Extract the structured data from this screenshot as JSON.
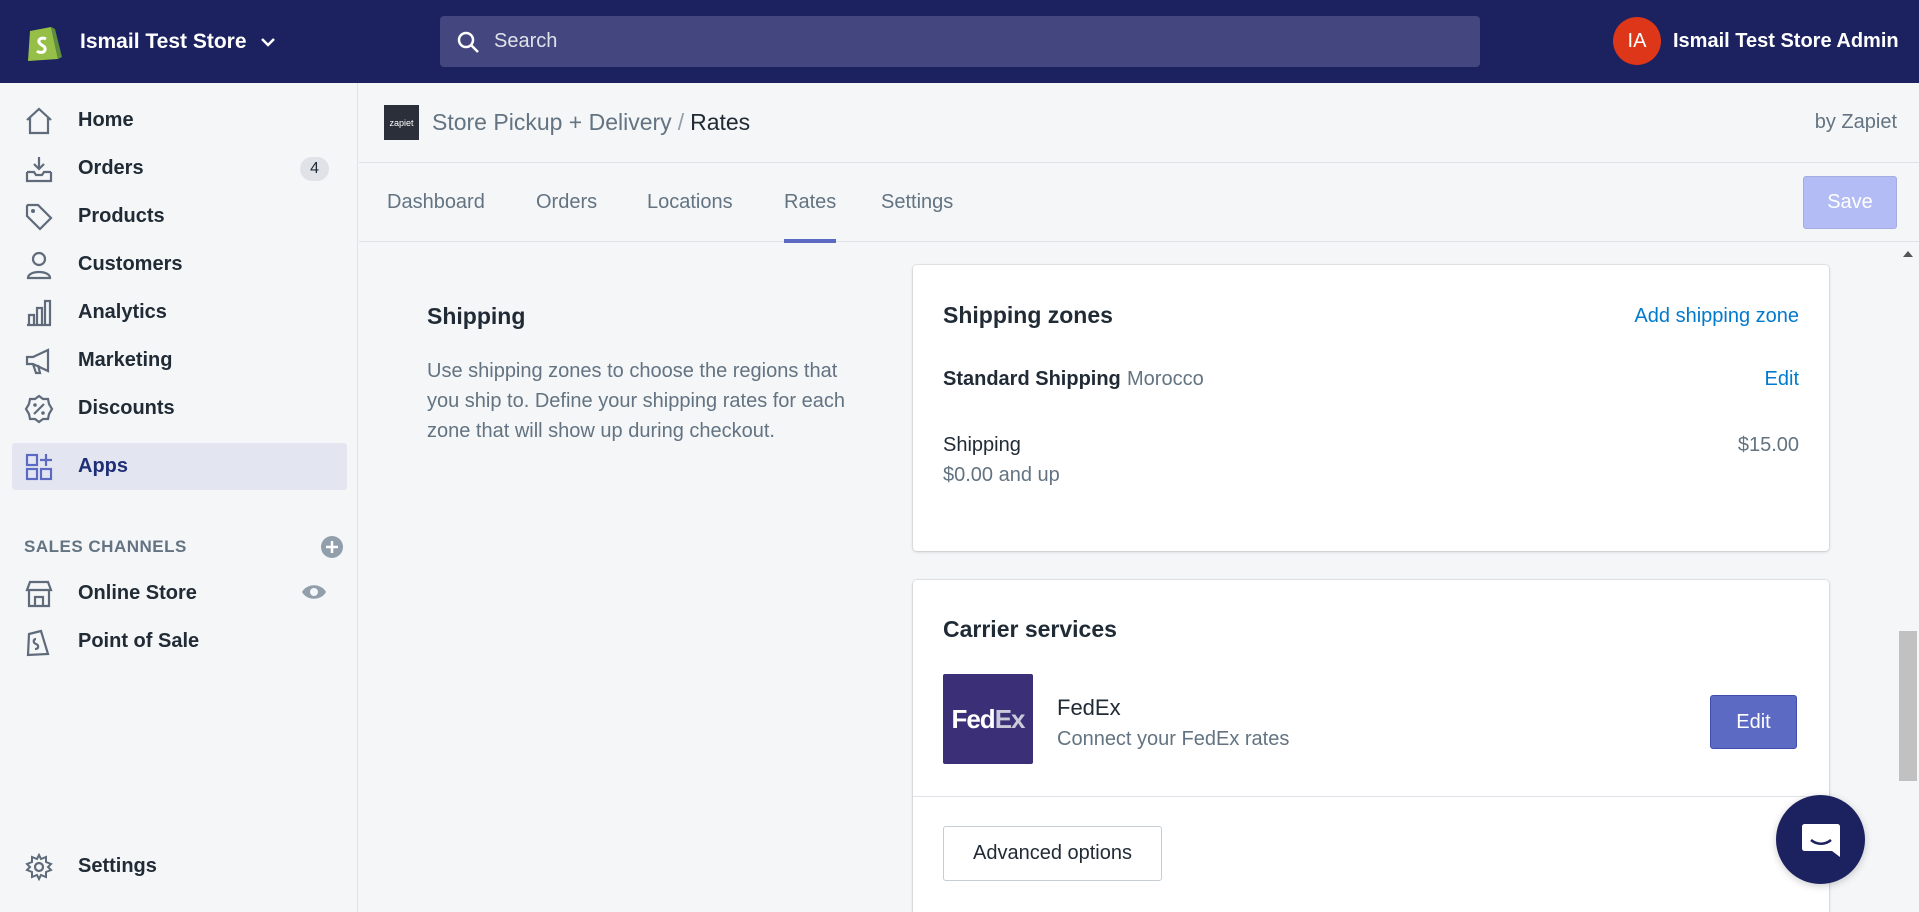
{
  "topbar": {
    "store_name": "Ismail Test Store",
    "search_placeholder": "Search",
    "avatar_initials": "IA",
    "account_name": "Ismail Test Store Admin"
  },
  "sidebar": {
    "items": [
      {
        "label": "Home",
        "icon": "home-icon"
      },
      {
        "label": "Orders",
        "icon": "orders-icon",
        "badge": "4"
      },
      {
        "label": "Products",
        "icon": "tag-icon"
      },
      {
        "label": "Customers",
        "icon": "person-icon"
      },
      {
        "label": "Analytics",
        "icon": "bar-chart-icon"
      },
      {
        "label": "Marketing",
        "icon": "megaphone-icon"
      },
      {
        "label": "Discounts",
        "icon": "discount-icon"
      },
      {
        "label": "Apps",
        "icon": "apps-icon",
        "active": true
      }
    ],
    "sales_channels_label": "SALES CHANNELS",
    "channels": [
      {
        "label": "Online Store",
        "icon": "store-icon"
      },
      {
        "label": "Point of Sale",
        "icon": "pos-icon"
      }
    ],
    "settings_label": "Settings"
  },
  "app": {
    "logo_text": "zapiet",
    "breadcrumb_parent": "Store Pickup + Delivery",
    "breadcrumb_sep": "/",
    "breadcrumb_current": "Rates",
    "by_text": "by Zapiet"
  },
  "tabs": [
    "Dashboard",
    "Orders",
    "Locations",
    "Rates",
    "Settings"
  ],
  "active_tab": "Rates",
  "save_label": "Save",
  "shipping": {
    "title": "Shipping",
    "description": "Use shipping zones to choose the regions that you ship to. Define your shipping rates for each zone that will show up during checkout."
  },
  "zones_card": {
    "title": "Shipping zones",
    "add_link": "Add shipping zone",
    "zone_name": "Standard Shipping",
    "zone_country": "Morocco",
    "edit_link": "Edit",
    "rate_name": "Shipping",
    "rate_condition": "$0.00 and up",
    "rate_price": "$15.00"
  },
  "carrier_card": {
    "title": "Carrier services",
    "logo_fed": "Fed",
    "logo_ex": "Ex",
    "carrier_name": "FedEx",
    "carrier_desc": "Connect your FedEx rates",
    "edit_label": "Edit",
    "advanced_label": "Advanced options"
  },
  "colors": {
    "topbar": "#1c2260",
    "primary": "#5c6ac4",
    "link": "#007ace",
    "avatar": "#de3618"
  }
}
